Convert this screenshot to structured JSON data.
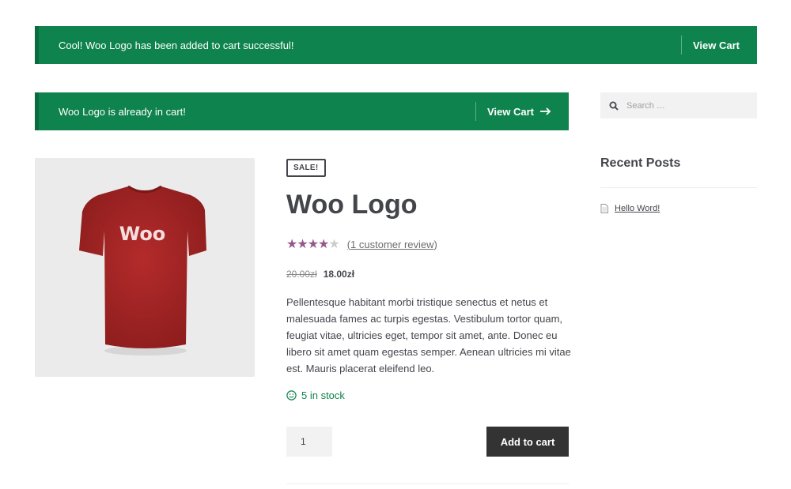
{
  "notices": {
    "added": {
      "message": "Cool! Woo Logo has been added to cart successful!",
      "link": "View Cart"
    },
    "in_cart": {
      "message": "Woo Logo is already in cart!",
      "link": "View Cart",
      "link_icon": "arrow-right-icon"
    }
  },
  "colors": {
    "notice_bg": "#0f834d",
    "star": "#96588a",
    "button_bg": "#333333",
    "stock": "#0f834d"
  },
  "search": {
    "placeholder": "Search …"
  },
  "sidebar": {
    "recent_posts_title": "Recent Posts",
    "posts": [
      {
        "label": "Hello Word!",
        "icon": "document-icon"
      }
    ]
  },
  "product": {
    "badge": "SALE!",
    "title": "Woo Logo",
    "image_text": "Woo",
    "rating": 4,
    "rating_max": 5,
    "review_link": "(1 customer review)",
    "old_price": "20.00zł",
    "new_price": "18.00zł",
    "description": "Pellentesque habitant morbi tristique senectus et netus et malesuada fames ac turpis egestas. Vestibulum tortor quam, feugiat vitae, ultricies eget, tempor sit amet, ante. Donec eu libero sit amet quam egestas semper. Aenean ultricies mi vitae est. Mauris placerat eleifend leo.",
    "stock": "5 in stock",
    "quantity": "1",
    "add_to_cart": "Add to cart"
  }
}
